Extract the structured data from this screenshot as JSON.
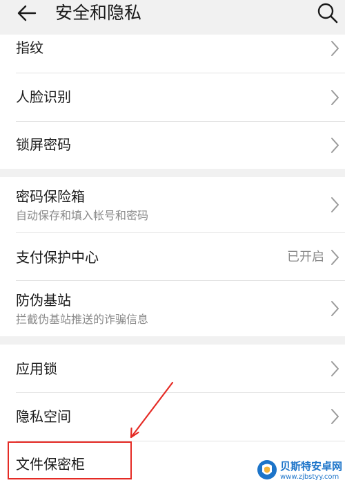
{
  "header": {
    "title": "安全和隐私",
    "back_icon": "arrow-left-icon",
    "search_icon": "search-icon"
  },
  "groups": [
    {
      "items": [
        {
          "title": "指纹",
          "subtitle": "",
          "value": ""
        },
        {
          "title": "人脸识别",
          "subtitle": "",
          "value": ""
        },
        {
          "title": "锁屏密码",
          "subtitle": "",
          "value": ""
        }
      ]
    },
    {
      "items": [
        {
          "title": "密码保险箱",
          "subtitle": "自动保存和填入帐号和密码",
          "value": ""
        },
        {
          "title": "支付保护中心",
          "subtitle": "",
          "value": "已开启"
        },
        {
          "title": "防伪基站",
          "subtitle": "拦截伪基站推送的诈骗信息",
          "value": ""
        }
      ]
    },
    {
      "items": [
        {
          "title": "应用锁",
          "subtitle": "",
          "value": ""
        },
        {
          "title": "隐私空间",
          "subtitle": "",
          "value": ""
        },
        {
          "title": "文件保密柜",
          "subtitle": "",
          "value": ""
        }
      ]
    }
  ],
  "watermark": {
    "name": "贝斯特安卓网",
    "url": "www.zjbstyy.com"
  },
  "colors": {
    "background": "#f1f1f1",
    "card": "#ffffff",
    "annotation": "#e52a24",
    "watermark": "#1c74c9"
  }
}
